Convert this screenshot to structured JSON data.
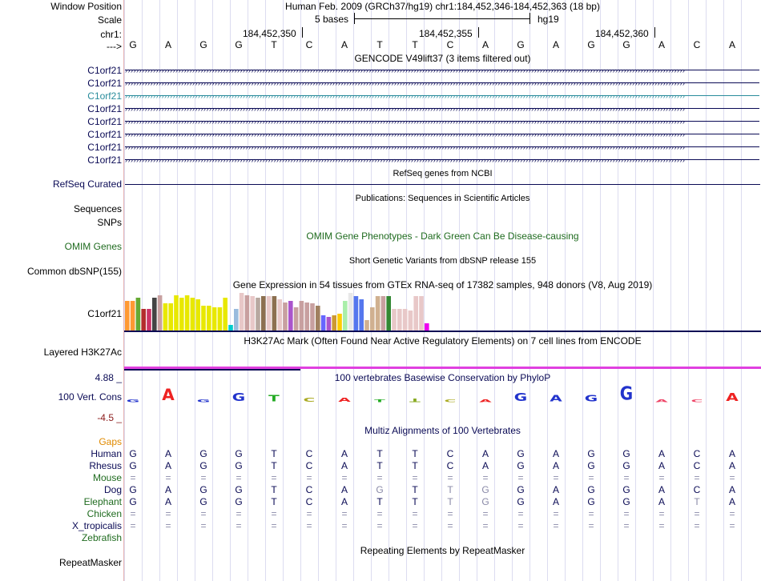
{
  "labels": {
    "window_position": "Window Position",
    "scale": "Scale",
    "chr": "chr1:",
    "strand": "--->",
    "gencode_items": [
      "C1orf21",
      "C1orf21",
      "C1orf21",
      "C1orf21",
      "C1orf21",
      "C1orf21",
      "C1orf21",
      "C1orf21"
    ],
    "refseq": "RefSeq Curated",
    "sequences": "Sequences",
    "snps": "SNPs",
    "omim": "OMIM Genes",
    "dbsnp": "Common dbSNP(155)",
    "gtex_gene": "C1orf21",
    "h3k27ac": "Layered H3K27Ac",
    "cons_max": "4.88 _",
    "cons_label": "100 Vert. Cons",
    "cons_min": "-4.5 _",
    "gaps": "Gaps",
    "species": [
      "Human",
      "Rhesus",
      "Mouse",
      "Dog",
      "Elephant",
      "Chicken",
      "X_tropicalis",
      "Zebrafish"
    ],
    "repeatmasker": "RepeatMasker"
  },
  "header": {
    "position_text": "Human Feb. 2009 (GRCh37/hg19)   chr1:184,452,346-184,452,363 (18 bp)",
    "scale_text": "5 bases",
    "assembly": "hg19",
    "coords": [
      "184,452,350",
      "184,452,355",
      "184,452,360"
    ]
  },
  "sequence": [
    "G",
    "A",
    "G",
    "G",
    "T",
    "C",
    "A",
    "T",
    "T",
    "C",
    "A",
    "G",
    "A",
    "G",
    "G",
    "A",
    "C",
    "A"
  ],
  "tracks": {
    "gencode_title": "GENCODE V49lift37 (3 items filtered out)",
    "refseq_title": "RefSeq genes from NCBI",
    "publications_title": "Publications: Sequences in Scientific Articles",
    "omim_title": "OMIM Gene Phenotypes - Dark Green Can Be Disease-causing",
    "dbsnp_title": "Short Genetic Variants from dbSNP release 155",
    "gtex_title": "Gene Expression in 54 tissues from GTEx RNA-seq of 17382 samples, 948 donors (V8, Aug 2019)",
    "h3k27ac_title": "H3K27Ac Mark (Often Found Near Active Regulatory Elements) on 7 cell lines from ENCODE",
    "phylop_title": "100 vertebrates Basewise Conservation by PhyloP",
    "multiz_title": "Multiz Alignments of 100 Vertebrates",
    "repeat_title": "Repeating Elements by RepeatMasker"
  },
  "alignment": {
    "Human": [
      "G",
      "A",
      "G",
      "G",
      "T",
      "C",
      "A",
      "T",
      "T",
      "C",
      "A",
      "G",
      "A",
      "G",
      "G",
      "A",
      "C",
      "A"
    ],
    "Rhesus": [
      "G",
      "A",
      "G",
      "G",
      "T",
      "C",
      "A",
      "T",
      "T",
      "C",
      "A",
      "G",
      "A",
      "G",
      "G",
      "A",
      "C",
      "A"
    ],
    "Mouse": [
      "=",
      "=",
      "=",
      "=",
      "=",
      "=",
      "=",
      "=",
      "=",
      "=",
      "=",
      "=",
      "=",
      "=",
      "=",
      "=",
      "=",
      "="
    ],
    "Dog": [
      "G",
      "A",
      "G",
      "G",
      "T",
      "C",
      "A",
      "G",
      "T",
      "T",
      "G",
      "G",
      "A",
      "G",
      "G",
      "A",
      "C",
      "A"
    ],
    "Elephant": [
      "G",
      "A",
      "G",
      "G",
      "T",
      "C",
      "A",
      "T",
      "T",
      "T",
      "G",
      "G",
      "A",
      "G",
      "G",
      "A",
      "T",
      "A"
    ],
    "Chicken": [
      "=",
      "=",
      "=",
      "=",
      "=",
      "=",
      "=",
      "=",
      "=",
      "=",
      "=",
      "=",
      "=",
      "=",
      "=",
      "=",
      "=",
      "="
    ],
    "X_tropicalis": [
      "=",
      "=",
      "=",
      "=",
      "=",
      "=",
      "=",
      "=",
      "=",
      "=",
      "=",
      "=",
      "=",
      "=",
      "=",
      "=",
      "=",
      "="
    ]
  },
  "colors": {
    "navy": "#0a0a55",
    "gencode_highlight": "#2a8c9c",
    "omim_green": "#1f6b1f",
    "gaps_orange": "#e08a00",
    "species_green": "#1f6b1f",
    "mismatch_gray": "#8a8aa8",
    "h3k27ac_magenta": "#e040e0"
  },
  "gtex_bars": {
    "values": [
      38,
      38,
      42,
      28,
      28,
      42,
      45,
      35,
      35,
      45,
      42,
      45,
      42,
      40,
      32,
      32,
      30,
      30,
      42,
      8,
      28,
      48,
      45,
      44,
      42,
      44,
      44,
      44,
      40,
      36,
      38,
      30,
      38,
      36,
      35,
      32,
      20,
      18,
      20,
      22,
      38,
      48,
      44,
      40,
      14,
      30,
      44,
      44,
      44,
      28,
      28,
      28,
      26,
      44,
      44,
      10
    ],
    "colors": [
      "#ff9933",
      "#ff9933",
      "#66aa33",
      "#b32d2d",
      "#cc3366",
      "#444444",
      "#c8a0a0",
      "#e8e800",
      "#e8e800",
      "#e8e800",
      "#e8e800",
      "#e8e800",
      "#e8e800",
      "#e8e800",
      "#e8e800",
      "#e8e800",
      "#e8e800",
      "#e8e800",
      "#e8e800",
      "#00cccc",
      "#99bbdd",
      "#e8c8c8",
      "#c8a0a0",
      "#e8c8c8",
      "#b8a8a0",
      "#8c7050",
      "#e8c8c8",
      "#8c7050",
      "#e8c8c8",
      "#c8a0a0",
      "#aa55cc",
      "#c8a0a0",
      "#c8a0a0",
      "#c8a0a0",
      "#c8a0a0",
      "#a08060",
      "#6666ff",
      "#aa55cc",
      "#cc9933",
      "#ffcc00",
      "#aaeeaa",
      "#e8e8e8",
      "#5577ee",
      "#5577ee",
      "#d0b090",
      "#d0b090",
      "#d0b090",
      "#c8a0a0",
      "#338833",
      "#e8c8c8",
      "#e8c8c8",
      "#e8c8c8",
      "#e8c8c8",
      "#e8c8c8",
      "#e8c8c8",
      "#ee00ee"
    ]
  },
  "phylop": {
    "glyphs": [
      "G",
      "A",
      "G",
      "G",
      "T",
      "C",
      "A",
      "T",
      "T",
      "C",
      "A",
      "G",
      "A",
      "G",
      "G",
      "A",
      "C",
      "A"
    ],
    "scores": [
      0.3,
      1.6,
      0.3,
      1.1,
      0.9,
      0.6,
      0.6,
      0.1,
      -0.5,
      0.2,
      0.3,
      1.1,
      0.9,
      0.9,
      1.9,
      0.2,
      0.2,
      1.1
    ],
    "colors": [
      "#2233cc",
      "#ee2222",
      "#2233cc",
      "#2233cc",
      "#22aa22",
      "#aaaa22",
      "#ee2222",
      "#22aa22",
      "#88aa22",
      "#aaaa22",
      "#ee2222",
      "#2233cc",
      "#2233cc",
      "#2233cc",
      "#2233cc",
      "#ee4466",
      "#ee4466",
      "#ee2222"
    ]
  }
}
